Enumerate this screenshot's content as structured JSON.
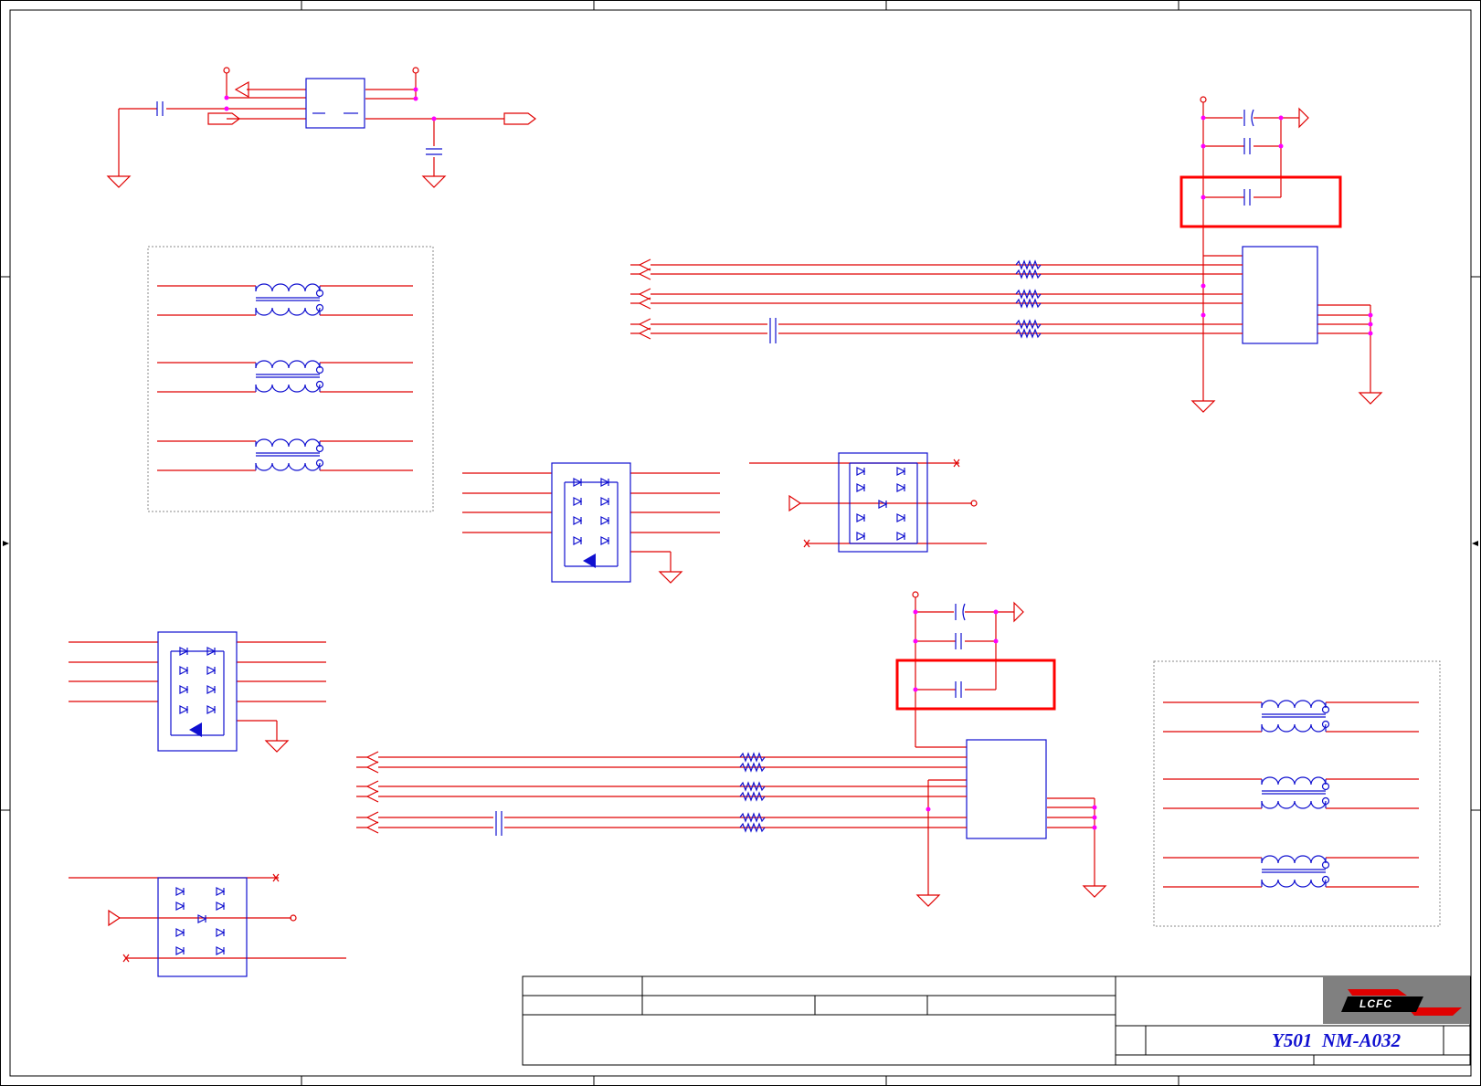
{
  "title_block": {
    "project": "Y501  NM-A032",
    "logo": "LCFC"
  },
  "colors": {
    "wire": "#e00000",
    "part": "#1010d0",
    "junction": "#ff00ff",
    "highlight": "#ff0000",
    "border": "#000000"
  },
  "icons": [
    "capacitor",
    "resistor",
    "common-mode-choke",
    "esd-diode-array",
    "ground",
    "power-arrow",
    "connector"
  ]
}
